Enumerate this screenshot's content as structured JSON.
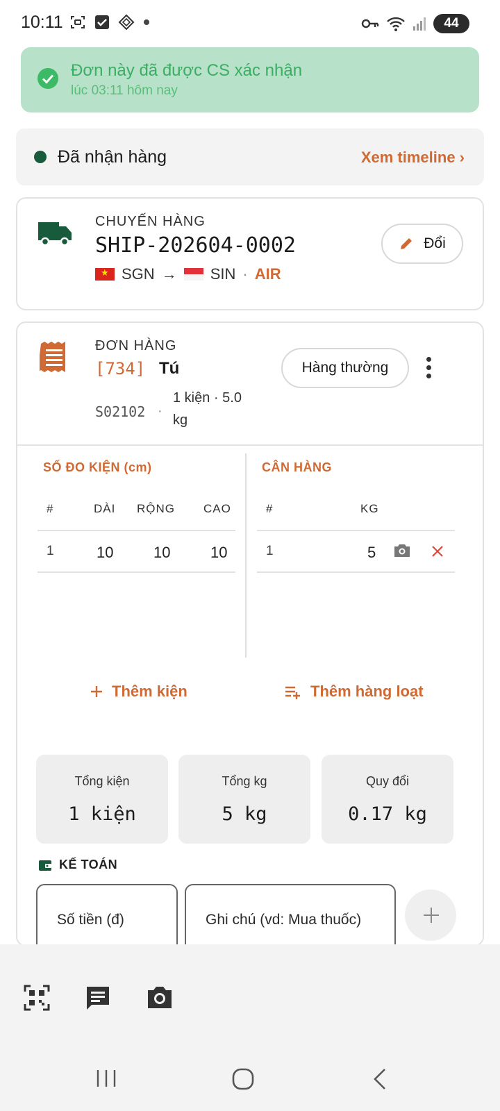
{
  "status_bar": {
    "time": "10:11",
    "battery": "44",
    "icons": [
      "screenshot-icon",
      "checkbox-icon",
      "app-icon",
      "dot-icon",
      "key-icon",
      "wifi-icon",
      "signal-icon",
      "battery-icon"
    ]
  },
  "banner": {
    "title": "Đơn này đã được CS xác nhận",
    "subtitle": "lúc 03:11 hôm nay",
    "color": "#b7e1c9"
  },
  "status_row": {
    "label": "Đã nhận hàng",
    "link": "Xem timeline ›"
  },
  "shipment": {
    "caption": "CHUYẾN HÀNG",
    "id": "SHIP-202604-0002",
    "origin": "SGN",
    "arrow": "→",
    "destination": "SIN",
    "separator": "·",
    "mode": "AIR",
    "edit_label": "Đổi"
  },
  "order": {
    "caption": "ĐƠN HÀNG",
    "code": "[734]",
    "name": "Tú",
    "sku": "S02102",
    "dot": "·",
    "qty_line1": "1 kiện · 5.0",
    "qty_line2": "kg",
    "type_label": "Hàng thường"
  },
  "dimensions": {
    "title": "SỐ ĐO KIỆN (cm)",
    "headers": [
      "#",
      "DÀI",
      "RỘNG",
      "CAO"
    ],
    "rows": [
      [
        "1",
        "10",
        "10",
        "10"
      ]
    ]
  },
  "weight": {
    "title": "CÂN HÀNG",
    "headers": [
      "#",
      "KG"
    ],
    "rows": [
      [
        "1",
        "5"
      ]
    ]
  },
  "actions": {
    "add_package": "Thêm kiện",
    "add_bulk": "Thêm hàng loạt"
  },
  "totals": [
    {
      "label": "Tổng kiện",
      "value": "1 kiện"
    },
    {
      "label": "Tổng kg",
      "value": "5 kg"
    },
    {
      "label": "Quy đổi",
      "value": "0.17 kg"
    }
  ],
  "accounting": {
    "title": "KẾ TOÁN",
    "amount_placeholder": "Số tiền (đ)",
    "note_placeholder": "Ghi chú (vd: Mua thuốc)"
  },
  "colors": {
    "accent": "#cf6a35",
    "dark_green": "#185a3c",
    "success": "#3dba66"
  }
}
